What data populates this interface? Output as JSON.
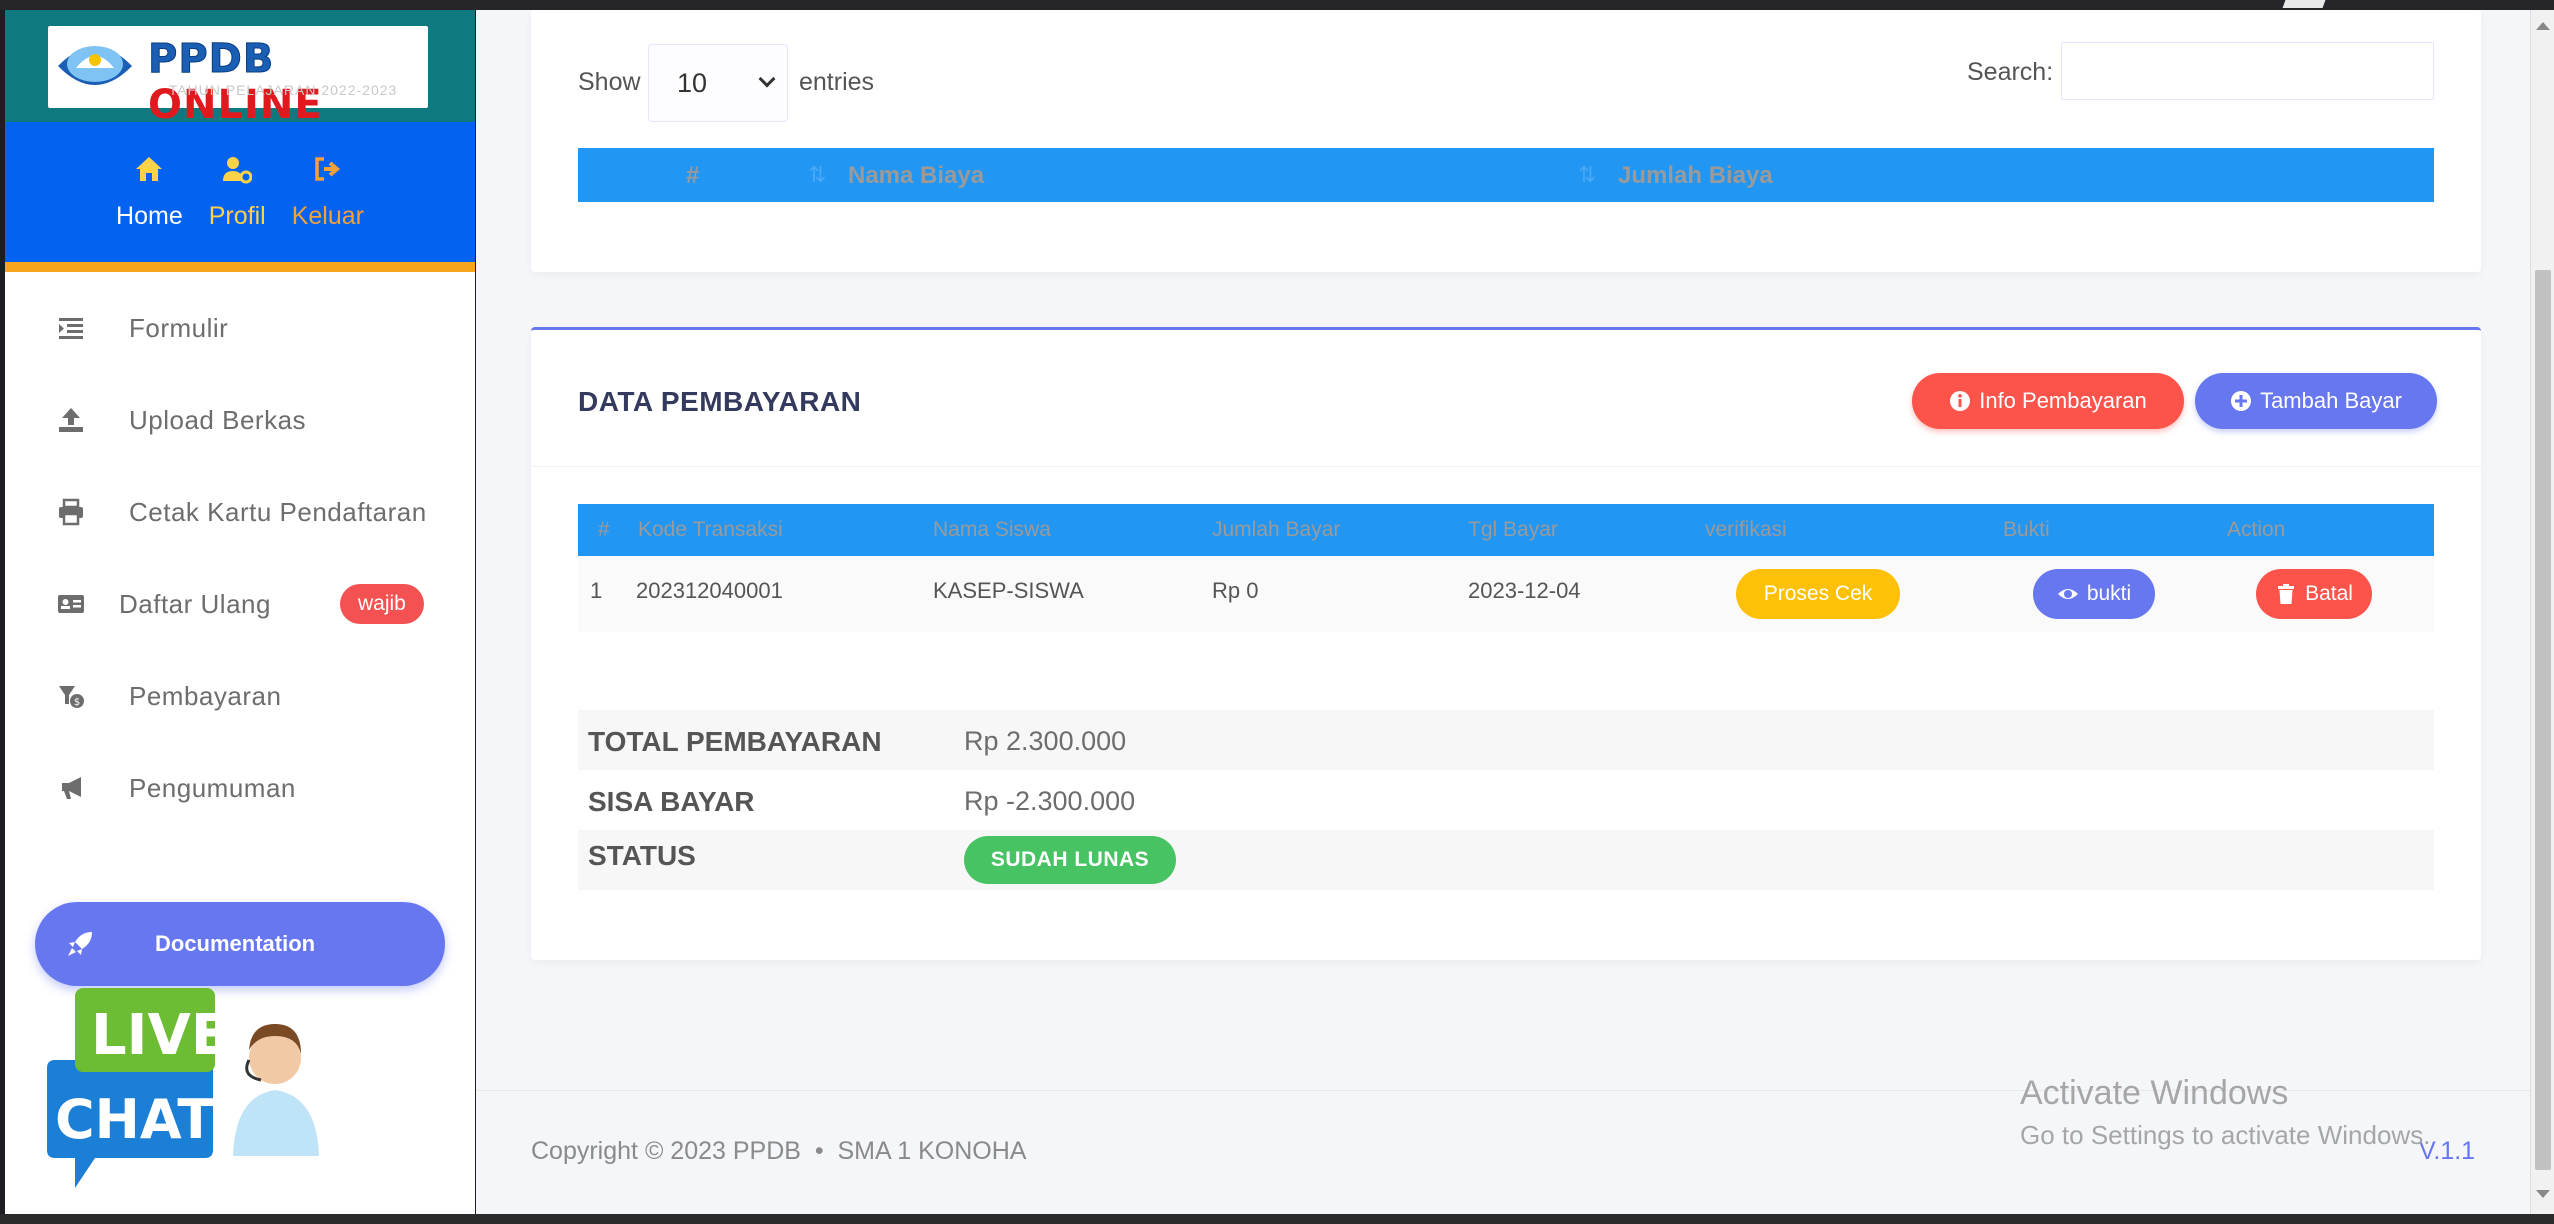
{
  "brand": {
    "title_main": "PPDB",
    "title_accent": "ONLINE",
    "subtitle": "TAHUN PELAJARAN 2022-2023"
  },
  "topnav": {
    "home": "Home",
    "profil": "Profil",
    "keluar": "Keluar"
  },
  "sidebar": {
    "items": [
      {
        "label": "Formulir",
        "icon": "list-icon"
      },
      {
        "label": "Upload Berkas",
        "icon": "upload-icon"
      },
      {
        "label": "Cetak Kartu Pendaftaran",
        "icon": "printer-icon"
      },
      {
        "label": "Daftar Ulang",
        "icon": "id-card-icon",
        "badge": "wajib"
      },
      {
        "label": "Pembayaran",
        "icon": "payment-icon"
      },
      {
        "label": "Pengumuman",
        "icon": "megaphone-icon"
      }
    ],
    "documentation": "Documentation",
    "livechat": {
      "line1": "LIVE",
      "line2": "CHAT"
    }
  },
  "biaya_table": {
    "show_label": "Show",
    "entries_value": "10",
    "entries_label": "entries",
    "search_label": "Search:",
    "search_value": "",
    "headers": [
      "#",
      "Nama Biaya",
      "Jumlah Biaya"
    ]
  },
  "pembayaran": {
    "title": "DATA PEMBAYARAN",
    "btn_info": "Info Pembayaran",
    "btn_tambah": "Tambah Bayar",
    "headers": [
      "#",
      "Kode Transaksi",
      "Nama Siswa",
      "Jumlah Bayar",
      "Tgl Bayar",
      "verifikasi",
      "Bukti",
      "Action"
    ],
    "rows": [
      {
        "no": "1",
        "kode": "202312040001",
        "nama": "KASEP-SISWA",
        "jumlah": "Rp 0",
        "tgl": "2023-12-04",
        "verifikasi": "Proses Cek",
        "bukti": "bukti",
        "action": "Batal"
      }
    ],
    "summary": {
      "total_label": "TOTAL PEMBAYARAN",
      "total_value": "Rp 2.300.000",
      "sisa_label": "SISA BAYAR",
      "sisa_value": "Rp -2.300.000",
      "status_label": "STATUS",
      "status_value": "SUDAH LUNAS"
    }
  },
  "footer": {
    "copyright": "Copyright © 2023 PPDB",
    "school": "SMA 1 KONOHA",
    "version": "V.1.1"
  },
  "watermark": {
    "line1": "Activate Windows",
    "line2": "Go to Settings to activate Windows."
  },
  "colors": {
    "primary": "#6777ef",
    "danger": "#fc544b",
    "warning": "#ffc107",
    "success": "#47c363",
    "table_header": "#2196f3",
    "sidebar_nav": "#0362f0",
    "brand_bg": "#0e7a80"
  }
}
